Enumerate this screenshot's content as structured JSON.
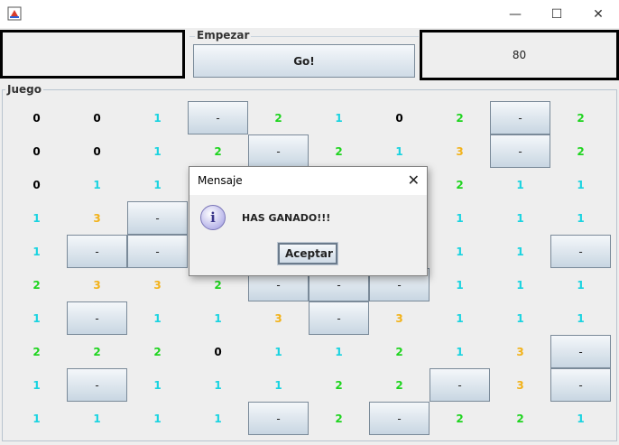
{
  "window": {
    "minimize_glyph": "—",
    "maximize_glyph": "☐",
    "close_glyph": "✕"
  },
  "top": {
    "start_legend": "Empezar",
    "go_label": "Go!",
    "score": "80"
  },
  "game": {
    "legend": "Juego",
    "colors": {
      "0": "#000000",
      "1": "#19d3e0",
      "2": "#1fd41f",
      "3": "#f2b21a"
    },
    "grid": [
      [
        "0",
        "0",
        "1",
        "-",
        "2",
        "1",
        "0",
        "2",
        "-",
        "2"
      ],
      [
        "0",
        "0",
        "1",
        "2",
        "-",
        "2",
        "1",
        "3",
        "-",
        "2"
      ],
      [
        "0",
        "1",
        "1",
        "",
        "",
        "",
        "",
        "2",
        "1",
        "1"
      ],
      [
        "1",
        "3",
        "-",
        "",
        "",
        "",
        "",
        "1",
        "1",
        "1"
      ],
      [
        "1",
        "-",
        "-",
        "",
        "",
        "",
        "",
        "1",
        "1",
        "-"
      ],
      [
        "2",
        "3",
        "3",
        "2",
        "-",
        "-",
        "-",
        "1",
        "1",
        "1"
      ],
      [
        "1",
        "-",
        "1",
        "1",
        "3",
        "-",
        "3",
        "1",
        "1",
        "1"
      ],
      [
        "2",
        "2",
        "2",
        "0",
        "1",
        "1",
        "2",
        "1",
        "3",
        "-"
      ],
      [
        "1",
        "-",
        "1",
        "1",
        "1",
        "2",
        "2",
        "-",
        "3",
        "-"
      ],
      [
        "1",
        "1",
        "1",
        "1",
        "-",
        "2",
        "-",
        "2",
        "2",
        "1"
      ]
    ]
  },
  "dialog": {
    "title": "Mensaje",
    "message": "HAS GANADO!!!",
    "ok_label": "Aceptar",
    "close_glyph": "✕",
    "info_glyph": "i"
  }
}
